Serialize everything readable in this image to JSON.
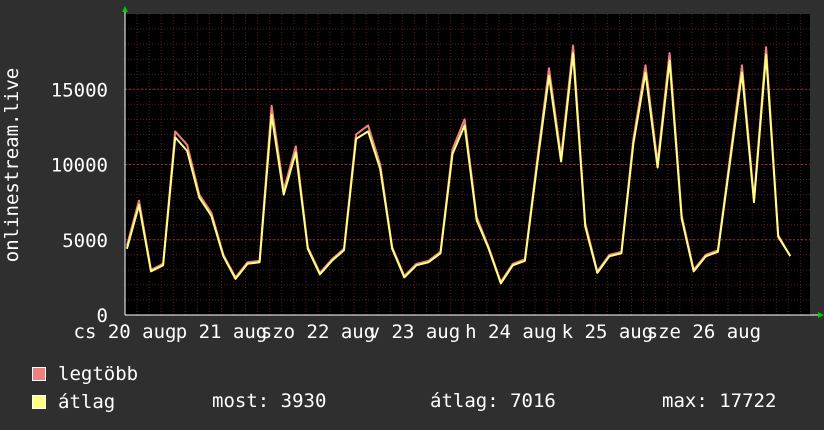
{
  "chart_data": {
    "type": "line",
    "ylabel": "onlinestream.live",
    "y_ticks": [
      0,
      5000,
      10000,
      15000
    ],
    "ylim": [
      0,
      20000
    ],
    "grid": true,
    "x_ticks": [
      "cs 20 aug",
      "p 21 aug",
      "szo 22 aug",
      "v 23 aug",
      "h 24 aug",
      "k 25 aug",
      "sze 26 aug"
    ],
    "x": [
      "cs 20 aug 00:00",
      "cs 20 aug 03:00",
      "cs 20 aug 06:00",
      "cs 20 aug 09:00",
      "cs 20 aug 12:00",
      "cs 20 aug 15:00",
      "cs 20 aug 18:00",
      "cs 20 aug 21:00",
      "p 21 aug 00:00",
      "p 21 aug 03:00",
      "p 21 aug 06:00",
      "p 21 aug 09:00",
      "p 21 aug 12:00",
      "p 21 aug 15:00",
      "p 21 aug 18:00",
      "p 21 aug 21:00",
      "szo 22 aug 00:00",
      "szo 22 aug 03:00",
      "szo 22 aug 06:00",
      "szo 22 aug 09:00",
      "szo 22 aug 12:00",
      "szo 22 aug 15:00",
      "szo 22 aug 18:00",
      "szo 22 aug 21:00",
      "v 23 aug 00:00",
      "v 23 aug 03:00",
      "v 23 aug 06:00",
      "v 23 aug 09:00",
      "v 23 aug 12:00",
      "v 23 aug 15:00",
      "v 23 aug 18:00",
      "v 23 aug 21:00",
      "h 24 aug 00:00",
      "h 24 aug 03:00",
      "h 24 aug 06:00",
      "h 24 aug 09:00",
      "h 24 aug 12:00",
      "h 24 aug 15:00",
      "h 24 aug 18:00",
      "h 24 aug 21:00",
      "k 25 aug 00:00",
      "k 25 aug 03:00",
      "k 25 aug 06:00",
      "k 25 aug 09:00",
      "k 25 aug 12:00",
      "k 25 aug 15:00",
      "k 25 aug 18:00",
      "k 25 aug 21:00",
      "sze 26 aug 00:00",
      "sze 26 aug 03:00",
      "sze 26 aug 06:00",
      "sze 26 aug 09:00",
      "sze 26 aug 12:00",
      "sze 26 aug 15:00",
      "sze 26 aug 18:00",
      "sze 26 aug 21:00"
    ],
    "series": [
      {
        "name": "legtöbb",
        "color": "#f08080",
        "values": [
          4600,
          7600,
          3000,
          3400,
          12200,
          11300,
          8000,
          6800,
          4000,
          2500,
          3500,
          3600,
          13900,
          8300,
          11200,
          4500,
          2800,
          3700,
          4400,
          12000,
          12600,
          10000,
          4500,
          2600,
          3400,
          3600,
          4200,
          11000,
          13000,
          6500,
          4500,
          2200,
          3400,
          3700,
          10200,
          16400,
          10500,
          17900,
          6100,
          2900,
          4000,
          4200,
          11700,
          16600,
          10100,
          17400,
          6600,
          3000,
          4000,
          4300,
          10400,
          16600,
          7700,
          17800,
          5300,
          3900
        ]
      },
      {
        "name": "átlag",
        "color": "#ffff80",
        "values": [
          4400,
          7300,
          2900,
          3300,
          11800,
          10900,
          7800,
          6600,
          3900,
          2400,
          3400,
          3500,
          13300,
          8000,
          10800,
          4400,
          2700,
          3600,
          4300,
          11700,
          12200,
          9700,
          4400,
          2500,
          3300,
          3500,
          4100,
          10700,
          12600,
          6300,
          4400,
          2100,
          3300,
          3600,
          9900,
          15900,
          10200,
          17400,
          5900,
          2800,
          3900,
          4100,
          11400,
          16100,
          9800,
          16900,
          6400,
          2900,
          3900,
          4200,
          10100,
          16100,
          7500,
          17300,
          5200,
          3930
        ]
      }
    ]
  },
  "legend": [
    {
      "label": "legtöbb",
      "color": "#f08080"
    },
    {
      "label": "átlag",
      "color": "#ffff80"
    }
  ],
  "stats": {
    "most": "most: 3930",
    "atlag": "átlag: 7016",
    "max": "max: 17722"
  }
}
